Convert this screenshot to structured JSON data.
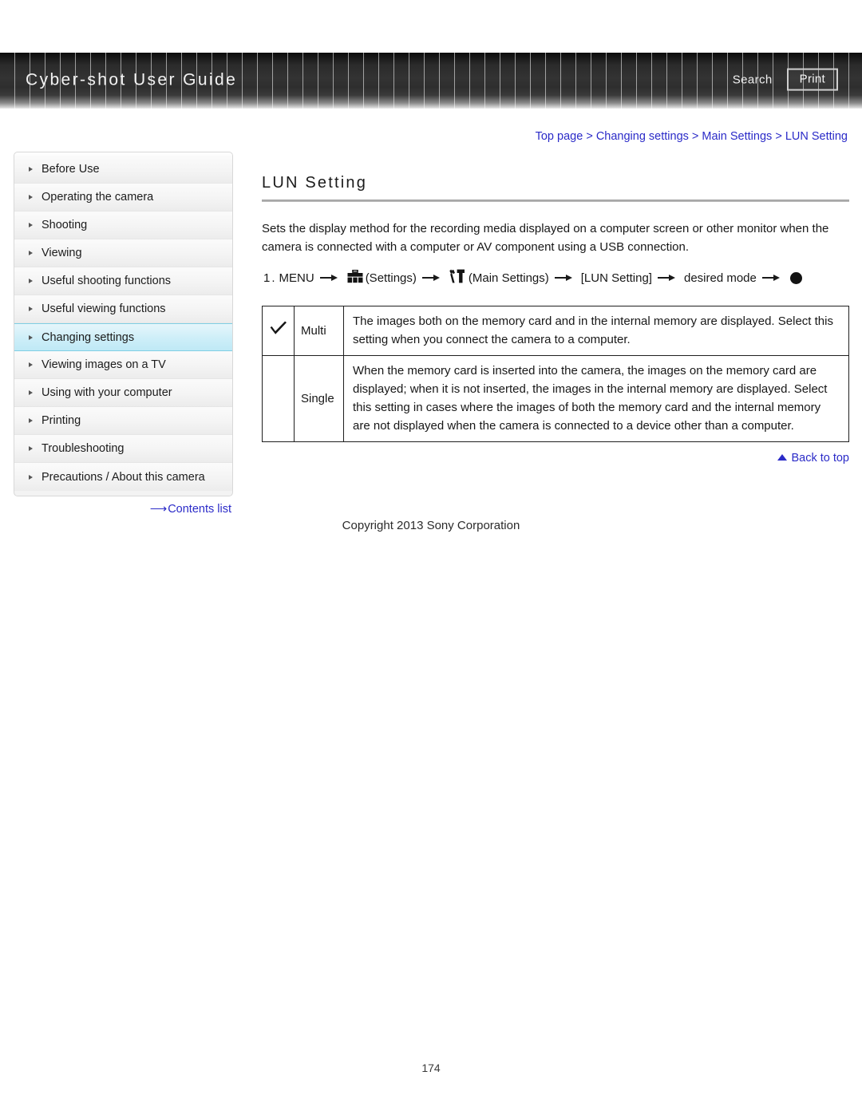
{
  "header": {
    "title": "Cyber-shot User Guide",
    "search_label": "Search",
    "print_label": "Print"
  },
  "breadcrumb": {
    "full": "Top page > Changing settings > Main Settings > LUN Setting",
    "items": [
      "Top page",
      "Changing settings",
      "Main Settings",
      "LUN Setting"
    ],
    "separator": ">"
  },
  "sidebar": {
    "items": [
      {
        "label": "Before Use",
        "active": false
      },
      {
        "label": "Operating the camera",
        "active": false
      },
      {
        "label": "Shooting",
        "active": false
      },
      {
        "label": "Viewing",
        "active": false
      },
      {
        "label": "Useful shooting functions",
        "active": false
      },
      {
        "label": "Useful viewing functions",
        "active": false
      },
      {
        "label": "Changing settings",
        "active": true
      },
      {
        "label": "Viewing images on a TV",
        "active": false
      },
      {
        "label": "Using with your computer",
        "active": false
      },
      {
        "label": "Printing",
        "active": false
      },
      {
        "label": "Troubleshooting",
        "active": false
      },
      {
        "label": "Precautions / About this camera",
        "active": false
      }
    ],
    "contents_list_label": "Contents list"
  },
  "main": {
    "title": "LUN Setting",
    "intro": "Sets the display method for the recording media displayed on a computer screen or other monitor when the camera is connected with a computer or AV component using a USB connection.",
    "step": {
      "number": "1.",
      "menu_label": "MENU",
      "settings_label": "(Settings)",
      "main_settings_label": "(Main Settings)",
      "item_label": "[LUN Setting]",
      "mode_label": "desired mode",
      "settings_icon": "toolbox-icon",
      "main_settings_icon": "wrench-screwdriver-icon",
      "end_icon": "filled-circle-icon",
      "arrow_icon": "right-arrow-icon"
    },
    "table": {
      "rows": [
        {
          "checked": true,
          "check_icon": "checkmark-icon",
          "name": "Multi",
          "description": "The images both on the memory card and in the internal memory are displayed. Select this setting when you connect the camera to a computer."
        },
        {
          "checked": false,
          "check_icon": "",
          "name": "Single",
          "description": "When the memory card is inserted into the camera, the images on the memory card are displayed; when it is not inserted, the images in the internal memory are displayed. Select this setting in cases where the images of both the memory card and the internal memory are not displayed when the camera is connected to a device other than a computer."
        }
      ]
    },
    "back_to_top_label": "Back to top"
  },
  "footer": {
    "copyright": "Copyright 2013 Sony Corporation",
    "page_number": "174"
  },
  "colors": {
    "link": "#2b2bc8",
    "header_bg": "#2e2e2e",
    "active_nav": "#cdeef8"
  }
}
